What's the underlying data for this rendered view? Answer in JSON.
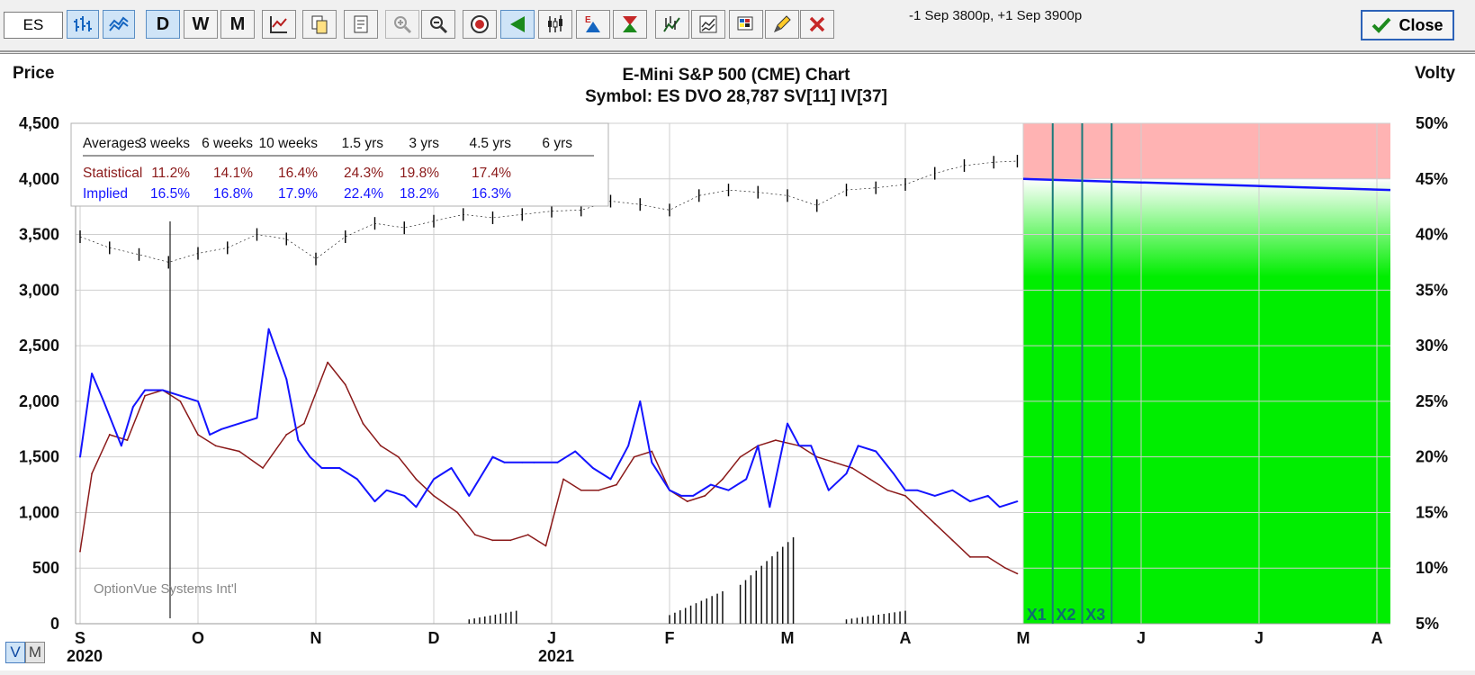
{
  "toolbar": {
    "symbol_value": "ES",
    "status": "-1 Sep 3800p, +1 Sep 3900p",
    "close_label": "Close",
    "buttons": [
      {
        "name": "bar-chart-icon-button",
        "kind": "icon",
        "icon": "bar-chart-icon",
        "selected": true
      },
      {
        "name": "line-chart-icon-button",
        "kind": "icon",
        "icon": "line-chart-icon",
        "selected": true
      },
      {
        "name": "daily-button",
        "kind": "text",
        "label": "D",
        "selected": true
      },
      {
        "name": "weekly-button",
        "kind": "text",
        "label": "W"
      },
      {
        "name": "monthly-button",
        "kind": "text",
        "label": "M"
      },
      {
        "name": "indicator-button",
        "kind": "icon",
        "icon": "indicator-icon"
      },
      {
        "name": "copy-button",
        "kind": "icon",
        "icon": "copy-icon"
      },
      {
        "name": "print-button",
        "kind": "icon",
        "icon": "print-icon"
      },
      {
        "name": "zoom-in-button",
        "kind": "icon",
        "icon": "zoom-in-icon",
        "disabled": true
      },
      {
        "name": "zoom-out-button",
        "kind": "icon",
        "icon": "zoom-out-icon"
      },
      {
        "name": "target-button",
        "kind": "icon",
        "icon": "target-icon"
      },
      {
        "name": "volatility-cone-button",
        "kind": "icon",
        "icon": "cone-icon",
        "selected": true
      },
      {
        "name": "candlestick-button",
        "kind": "icon",
        "icon": "candlestick-icon"
      },
      {
        "name": "earnings-button",
        "kind": "icon",
        "icon": "earnings-icon"
      },
      {
        "name": "dividend-button",
        "kind": "icon",
        "icon": "dividend-icon"
      },
      {
        "name": "study-button",
        "kind": "icon",
        "icon": "study-icon"
      },
      {
        "name": "compare-button",
        "kind": "icon",
        "icon": "compare-icon"
      },
      {
        "name": "palette-button",
        "kind": "icon",
        "icon": "palette-icon"
      },
      {
        "name": "draw-button",
        "kind": "icon",
        "icon": "pencil-icon"
      },
      {
        "name": "delete-button",
        "kind": "icon",
        "icon": "delete-icon"
      }
    ]
  },
  "view_toggle": {
    "v": "V",
    "m": "M",
    "active": "V"
  },
  "colors": {
    "price": "#000000",
    "implied": "#1414ff",
    "statistical": "#8b1a1a",
    "future_green": "#00ee00",
    "future_red": "#ffb3b3",
    "expiry_line": "#1a7a7a",
    "grid": "#cfcfcf"
  },
  "chart_data": {
    "type": "line",
    "title": "E-Mini S&P 500 (CME) Chart",
    "subtitle": "Symbol: ES  DVO 28,787  SV[11]  IV[37]",
    "left_axis_label": "Price",
    "right_axis_label": "Volty",
    "left_ylim": [
      0,
      4500
    ],
    "left_ticks": [
      "4,500",
      "4,000",
      "3,500",
      "3,000",
      "2,500",
      "2,000",
      "1,500",
      "1,000",
      "500",
      "0"
    ],
    "right_ylim": [
      5,
      50
    ],
    "right_ticks": [
      "50%",
      "45%",
      "40%",
      "35%",
      "30%",
      "25%",
      "20%",
      "15%",
      "10%",
      "5%"
    ],
    "x_months": [
      "S",
      "O",
      "N",
      "D",
      "J",
      "F",
      "M",
      "A",
      "M",
      "J",
      "J",
      "A"
    ],
    "x_years": [
      {
        "label": "2020",
        "month": 0
      },
      {
        "label": "2021",
        "month": 4
      }
    ],
    "watermark": "OptionVue Systems Int'l",
    "averages": {
      "header": [
        "Averages",
        "3 weeks",
        "6 weeks",
        "10 weeks",
        "1.5 yrs",
        "3 yrs",
        "4.5 yrs",
        "6 yrs"
      ],
      "statistical": {
        "label": "Statistical",
        "values": [
          "11.2%",
          "14.1%",
          "16.4%",
          "24.3%",
          "19.8%",
          "17.4%",
          ""
        ]
      },
      "implied": {
        "label": "Implied",
        "values": [
          "16.5%",
          "16.8%",
          "17.9%",
          "22.4%",
          "18.2%",
          "16.3%",
          ""
        ]
      }
    },
    "expirations": [
      "X1",
      "X2",
      "X3"
    ],
    "expiration_months": [
      8.25,
      8.5,
      8.75
    ],
    "projection_start_month": 8.0,
    "projected_iv": {
      "start": 45.0,
      "end": 44.0
    },
    "price_series": {
      "months": [
        0,
        0.25,
        0.5,
        0.75,
        1.0,
        1.25,
        1.5,
        1.75,
        2.0,
        2.25,
        2.5,
        2.75,
        3.0,
        3.25,
        3.5,
        3.75,
        4.0,
        4.25,
        4.5,
        4.75,
        5.0,
        5.25,
        5.5,
        5.75,
        6.0,
        6.25,
        6.5,
        6.75,
        7.0,
        7.25,
        7.5,
        7.75,
        7.95
      ],
      "values": [
        3480,
        3380,
        3320,
        3250,
        3330,
        3380,
        3500,
        3460,
        3280,
        3480,
        3600,
        3560,
        3620,
        3680,
        3650,
        3680,
        3710,
        3720,
        3800,
        3770,
        3720,
        3850,
        3900,
        3880,
        3850,
        3760,
        3900,
        3920,
        3950,
        4050,
        4120,
        4150,
        4160
      ]
    },
    "implied_vol": {
      "months": [
        0,
        0.1,
        0.2,
        0.35,
        0.45,
        0.55,
        0.7,
        0.85,
        1.0,
        1.1,
        1.2,
        1.35,
        1.5,
        1.6,
        1.75,
        1.85,
        1.95,
        2.05,
        2.2,
        2.35,
        2.5,
        2.6,
        2.75,
        2.85,
        3.0,
        3.15,
        3.3,
        3.5,
        3.6,
        3.75,
        3.85,
        4.05,
        4.2,
        4.35,
        4.5,
        4.65,
        4.75,
        4.85,
        5.0,
        5.1,
        5.2,
        5.35,
        5.5,
        5.65,
        5.75,
        5.85,
        6.0,
        6.1,
        6.2,
        6.35,
        6.5,
        6.6,
        6.75,
        6.9,
        7.0,
        7.1,
        7.25,
        7.4,
        7.55,
        7.7,
        7.8,
        7.95
      ],
      "values": [
        20,
        27.5,
        25,
        21,
        24.5,
        26,
        26,
        25.5,
        25,
        22,
        22.5,
        23,
        23.5,
        31.5,
        27,
        21.5,
        20,
        19,
        19,
        18,
        16,
        17,
        16.5,
        15.5,
        18,
        19,
        16.5,
        20,
        19.5,
        19.5,
        19.5,
        19.5,
        20.5,
        19,
        18,
        21,
        25,
        19.5,
        17,
        16.5,
        16.5,
        17.5,
        17,
        18,
        21,
        15.5,
        23,
        21,
        21,
        17,
        18.5,
        21,
        20.5,
        18.5,
        17,
        17,
        16.5,
        17,
        16,
        16.5,
        15.5,
        16
      ]
    },
    "statistical_vol": {
      "months": [
        0,
        0.1,
        0.25,
        0.4,
        0.55,
        0.7,
        0.85,
        1.0,
        1.15,
        1.35,
        1.55,
        1.75,
        1.9,
        2.1,
        2.25,
        2.4,
        2.55,
        2.7,
        2.85,
        3.0,
        3.2,
        3.35,
        3.5,
        3.65,
        3.8,
        3.95,
        4.1,
        4.25,
        4.4,
        4.55,
        4.7,
        4.85,
        5.0,
        5.15,
        5.3,
        5.45,
        5.6,
        5.75,
        5.9,
        6.1,
        6.25,
        6.4,
        6.55,
        6.7,
        6.85,
        7.0,
        7.1,
        7.25,
        7.4,
        7.55,
        7.7,
        7.85,
        7.95
      ],
      "values": [
        11.5,
        18.5,
        22,
        21.5,
        25.5,
        26,
        25,
        22,
        21,
        20.5,
        19,
        22,
        23,
        28.5,
        26.5,
        23,
        21,
        20,
        18,
        16.5,
        15,
        13,
        12.5,
        12.5,
        13,
        12,
        18,
        17,
        17,
        17.5,
        20,
        20.5,
        17,
        16,
        16.5,
        18,
        20,
        21,
        21.5,
        21,
        20,
        19.5,
        19,
        18,
        17,
        16.5,
        15.5,
        14,
        12.5,
        11,
        11,
        10,
        9.5
      ]
    },
    "volume_bars": {
      "groups": [
        {
          "from": 5.0,
          "to": 5.45,
          "min": 40,
          "max": 150
        },
        {
          "from": 5.6,
          "to": 6.05,
          "min": 180,
          "max": 400
        },
        {
          "from": 3.3,
          "to": 3.7,
          "min": 20,
          "max": 60
        },
        {
          "from": 6.5,
          "to": 7.0,
          "min": 20,
          "max": 60
        }
      ]
    }
  }
}
